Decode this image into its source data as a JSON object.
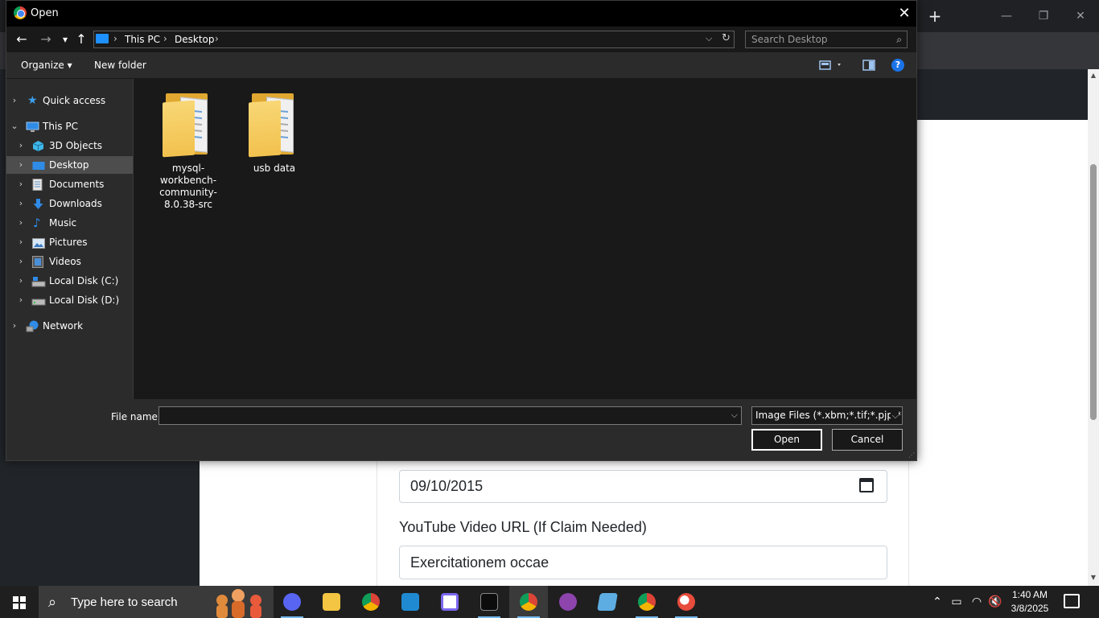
{
  "dialog": {
    "title": "Open",
    "close_glyph": "✕",
    "nav": {
      "back_glyph": "←",
      "forward_glyph": "→",
      "recent_glyph": "▾",
      "up_glyph": "↑"
    },
    "address": {
      "crumbs": [
        "This PC",
        "Desktop"
      ],
      "separator": "›",
      "dropdown_glyph": "⌵",
      "refresh_glyph": "↻"
    },
    "search": {
      "placeholder": "Search Desktop",
      "icon": "search-icon"
    },
    "commands": {
      "organize": "Organize ▾",
      "new_folder": "New folder",
      "help": "?"
    },
    "tree": [
      {
        "label": "Quick access",
        "icon": "star-icon",
        "chevron": "›",
        "level": 0
      },
      {
        "label": "This PC",
        "icon": "computer-icon",
        "chevron": "⌄",
        "level": 0
      },
      {
        "label": "3D Objects",
        "icon": "cube-icon",
        "chevron": "›",
        "level": 1
      },
      {
        "label": "Desktop",
        "icon": "desktop-icon",
        "chevron": "›",
        "level": 1,
        "selected": true
      },
      {
        "label": "Documents",
        "icon": "document-icon",
        "chevron": "›",
        "level": 1
      },
      {
        "label": "Downloads",
        "icon": "download-icon",
        "chevron": "›",
        "level": 1
      },
      {
        "label": "Music",
        "icon": "music-icon",
        "chevron": "›",
        "level": 1
      },
      {
        "label": "Pictures",
        "icon": "picture-icon",
        "chevron": "›",
        "level": 1
      },
      {
        "label": "Videos",
        "icon": "video-icon",
        "chevron": "›",
        "level": 1
      },
      {
        "label": "Local Disk (C:)",
        "icon": "drive-icon",
        "chevron": "›",
        "level": 1
      },
      {
        "label": "Local Disk (D:)",
        "icon": "drive-icon",
        "chevron": "›",
        "level": 1
      },
      {
        "label": "Network",
        "icon": "network-icon",
        "chevron": "›",
        "level": 0
      }
    ],
    "folders": [
      {
        "name": "mysql-workbench-community-8.0.38-src"
      },
      {
        "name": "usb data"
      }
    ],
    "file_name": {
      "label": "File name:",
      "value": "",
      "dropdown_glyph": "⌵"
    },
    "file_type": {
      "selected": "Image Files (*.xbm;*.tif;*.pjp;*.a",
      "dropdown_glyph": "⌵"
    },
    "buttons": {
      "open": "Open",
      "cancel": "Cancel"
    }
  },
  "browser": {
    "new_tab_glyph": "+",
    "minimize_glyph": "—",
    "restore_glyph": "❐",
    "close_glyph": "✕",
    "toolbar_icons": [
      "star-icon",
      "extensions-icon",
      "download-icon",
      "more-icon"
    ],
    "user_menu_glyph": "👤▾"
  },
  "page": {
    "date_value": "09/10/2015",
    "youtube_label": "YouTube Video URL (If Claim Needed)",
    "youtube_value": "Exercitationem occae"
  },
  "taskbar": {
    "search_placeholder": "Type here to search",
    "apps": [
      {
        "name": "discord",
        "color": "#5865f2"
      },
      {
        "name": "file-explorer",
        "color": "#f4c542"
      },
      {
        "name": "chrome",
        "color": "#db4437"
      },
      {
        "name": "vscode",
        "color": "#1f8ad2"
      },
      {
        "name": "clickup",
        "color": "#7b68ee"
      },
      {
        "name": "terminal",
        "color": "#2d2d2d"
      },
      {
        "name": "chrome-active",
        "color": "#db4437"
      },
      {
        "name": "github-desktop",
        "color": "#8e44ad"
      },
      {
        "name": "notepad",
        "color": "#5dade2"
      },
      {
        "name": "chrome-profile",
        "color": "#db4437"
      },
      {
        "name": "paint",
        "color": "#e74c3c"
      }
    ],
    "clock_time": "1:40 AM",
    "clock_date": "3/8/2025"
  }
}
